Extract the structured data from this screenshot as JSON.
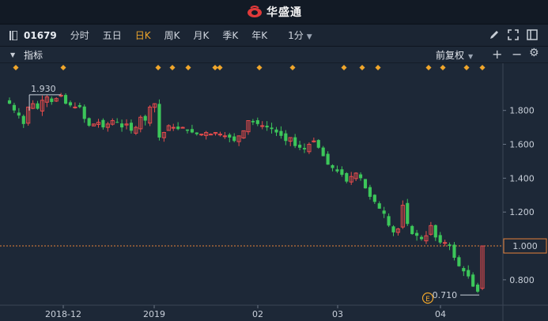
{
  "app": {
    "brand_name": "华盛通",
    "brand_color": "#e03a3a"
  },
  "toolbar": {
    "stock_code": "01679",
    "tabs": [
      {
        "label": "分时",
        "active": false
      },
      {
        "label": "五日",
        "active": false
      },
      {
        "label": "日K",
        "active": true
      },
      {
        "label": "周K",
        "active": false
      },
      {
        "label": "月K",
        "active": false
      },
      {
        "label": "季K",
        "active": false
      },
      {
        "label": "年K",
        "active": false
      }
    ],
    "interval_value": "1分",
    "right_icons": [
      "edit-icon",
      "fullscreen-icon",
      "split-view-icon"
    ]
  },
  "subbar": {
    "indicator_label": "指标",
    "adjust_label": "前复权",
    "icons": [
      "add-icon",
      "minus-icon",
      "settings-icon"
    ]
  },
  "chart": {
    "colors": {
      "up": "#e84c4c",
      "down": "#3cc65a",
      "ref_line": "#e8823a",
      "marker": "#f0a62b",
      "grid": "#2e3a4a"
    },
    "y_ticks": [
      "1.800",
      "1.600",
      "1.400",
      "1.200",
      "1.000",
      "0.800"
    ],
    "x_ticks": [
      "2018-12",
      "2019",
      "02",
      "03",
      "04"
    ],
    "max_label": "1.930",
    "min_label": "0.710",
    "ref_label": "1.000",
    "event_badge": "E",
    "event_markers_count": 16
  },
  "chart_data": {
    "type": "candlestick",
    "series_count": 1,
    "y_range": [
      0.65,
      1.99
    ],
    "reference_value": 1.0,
    "max_value": 1.93,
    "min_value": 0.71,
    "x_labels": [
      "2018-12",
      "2019",
      "02",
      "03",
      "04"
    ],
    "closes": [
      1.84,
      1.8,
      1.77,
      1.72,
      1.82,
      1.84,
      1.81,
      1.86,
      1.88,
      1.85,
      1.87,
      1.89,
      1.84,
      1.83,
      1.82,
      1.82,
      1.75,
      1.71,
      1.72,
      1.73,
      1.7,
      1.72,
      1.74,
      1.73,
      1.7,
      1.72,
      1.68,
      1.7,
      1.76,
      1.74,
      1.82,
      1.84,
      1.64,
      1.67,
      1.71,
      1.7,
      1.69,
      1.7,
      1.68,
      1.67,
      1.66,
      1.66,
      1.67,
      1.66,
      1.67,
      1.66,
      1.65,
      1.64,
      1.62,
      1.65,
      1.68,
      1.74,
      1.73,
      1.72,
      1.71,
      1.7,
      1.69,
      1.67,
      1.65,
      1.62,
      1.64,
      1.59,
      1.58,
      1.57,
      1.6,
      1.62,
      1.58,
      1.53,
      1.48,
      1.46,
      1.44,
      1.42,
      1.38,
      1.41,
      1.43,
      1.4,
      1.34,
      1.29,
      1.26,
      1.22,
      1.19,
      1.12,
      1.08,
      1.1,
      1.24,
      1.13,
      1.07,
      1.06,
      1.04,
      1.06,
      1.12,
      1.05,
      1.02,
      1.02,
      1.0,
      0.93,
      0.88,
      0.85,
      0.82,
      0.76,
      0.73,
      1.0
    ]
  }
}
